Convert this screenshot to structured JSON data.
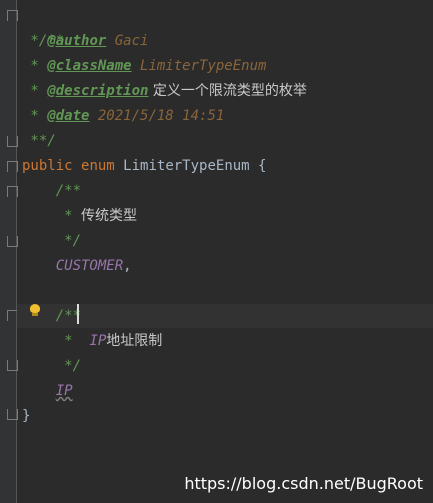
{
  "lines": {
    "l1": "/**",
    "l2_prefix": " * ",
    "l2_tag": "@author",
    "l2_val": " Gaci",
    "l3_prefix": " * ",
    "l3_tag": "@className",
    "l3_val": " LimiterTypeEnum",
    "l4_prefix": " * ",
    "l4_tag": "@description",
    "l4_val": " 定义一个限流类型的枚举",
    "l5_prefix": " * ",
    "l5_tag": "@date",
    "l5_val": " 2021/5/18 14:51",
    "l6": " **/",
    "l7_kw1": "public",
    "l7_kw2": "enum",
    "l7_name": "LimiterTypeEnum {",
    "l8": "    /**",
    "l9_prefix": "     * ",
    "l9_text": "传统类型",
    "l10": "     */",
    "l11_const": "CUSTOMER",
    "l11_comma": ",",
    "l13": "    /**",
    "l14_prefix": "     *  ",
    "l14_ip": "IP",
    "l14_text": "地址限制",
    "l15": "     */",
    "l16_const": "IP",
    "l17": "}"
  },
  "watermark": "https://blog.csdn.net/BugRoot"
}
